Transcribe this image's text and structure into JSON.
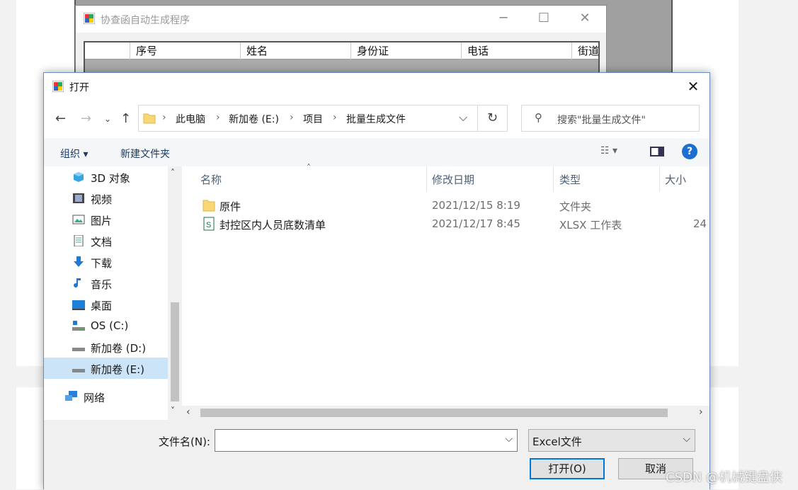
{
  "back_app": {
    "title": "协查函自动生成程序",
    "columns": [
      "序号",
      "姓名",
      "身份证",
      "电话",
      "街道"
    ]
  },
  "dialog": {
    "title": "打开",
    "breadcrumb": [
      "此电脑",
      "新加卷 (E:)",
      "项目",
      "批量生成文件"
    ],
    "search_placeholder": "搜索\"批量生成文件\"",
    "toolbar": {
      "organize": "组织 ▾",
      "new_folder": "新建文件夹"
    },
    "nav_items": [
      {
        "label": "3D 对象",
        "icon": "cube-3d-icon"
      },
      {
        "label": "视频",
        "icon": "video-icon"
      },
      {
        "label": "图片",
        "icon": "pictures-icon"
      },
      {
        "label": "文档",
        "icon": "documents-icon"
      },
      {
        "label": "下载",
        "icon": "download-icon"
      },
      {
        "label": "音乐",
        "icon": "music-icon"
      },
      {
        "label": "桌面",
        "icon": "desktop-icon"
      },
      {
        "label": "OS (C:)",
        "icon": "os-drive-icon"
      },
      {
        "label": "新加卷 (D:)",
        "icon": "drive-icon"
      },
      {
        "label": "新加卷 (E:)",
        "icon": "drive-icon"
      },
      {
        "label": "网络",
        "icon": "network-icon"
      }
    ],
    "columns": {
      "name": "名称",
      "modified": "修改日期",
      "type": "类型",
      "size": "大小"
    },
    "files": [
      {
        "name": "原件",
        "modified": "2021/12/15 8:19",
        "type": "文件夹",
        "size": "",
        "icon": "folder-icon"
      },
      {
        "name": "封控区内人员底数清单",
        "modified": "2021/12/17 8:45",
        "type": "XLSX 工作表",
        "size": "24",
        "icon": "excel-file-icon"
      }
    ],
    "filename_label": "文件名(N):",
    "filename_value": "",
    "filetype": "Excel文件",
    "open_button": "打开(O)",
    "cancel_button": "取消"
  },
  "watermark": "CSDN @机械键盘侠"
}
